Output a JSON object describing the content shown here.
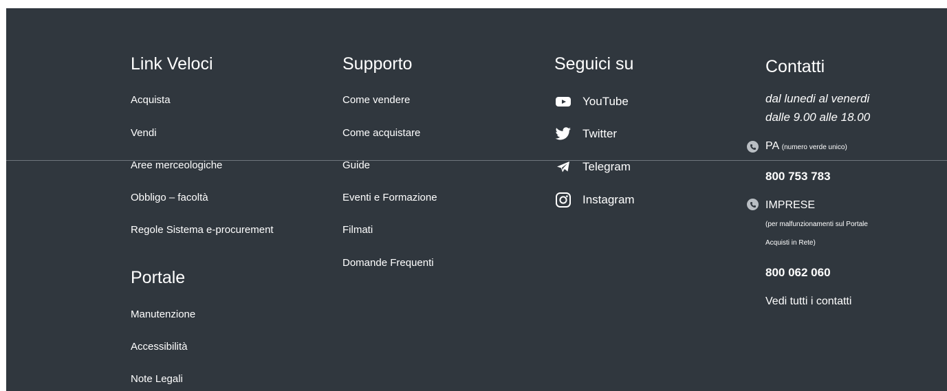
{
  "footer": {
    "quick_links": {
      "heading": "Link Veloci",
      "items": [
        "Acquista",
        "Vendi",
        "Aree merceologiche",
        "Obbligo – facoltà",
        "Regole Sistema e-procurement"
      ]
    },
    "portal": {
      "heading": "Portale",
      "items": [
        "Manutenzione",
        "Accessibilità",
        "Note Legali"
      ]
    },
    "support": {
      "heading": "Supporto",
      "items": [
        "Come vendere",
        "Come acquistare",
        "Guide",
        "Eventi e Formazione",
        "Filmati",
        "Domande Frequenti"
      ]
    },
    "social": {
      "heading": "Seguici su",
      "items": [
        {
          "label": "YouTube",
          "icon": "youtube-icon"
        },
        {
          "label": "Twitter",
          "icon": "twitter-icon"
        },
        {
          "label": "Telegram",
          "icon": "telegram-icon"
        },
        {
          "label": "Instagram",
          "icon": "instagram-icon"
        }
      ]
    },
    "contacts": {
      "heading": "Contatti",
      "hours_line1": "dal lunedi al venerdi",
      "hours_line2": "dalle 9.00 alle 18.00",
      "pa_label": "PA",
      "pa_note": "(numero verde unico)",
      "pa_phone": "800 753 783",
      "business_label": "IMPRESE",
      "business_note_line1": "(per malfunzionamenti sul Portale",
      "business_note_line2": "Acquisti in Rete)",
      "business_phone": "800 062 060",
      "all_contacts_link": "Vedi tutti i contatti"
    }
  },
  "colors": {
    "background": "#30373e",
    "text": "#ffffff",
    "divider": "#6f767d",
    "phone_icon": "#b9bec3"
  }
}
